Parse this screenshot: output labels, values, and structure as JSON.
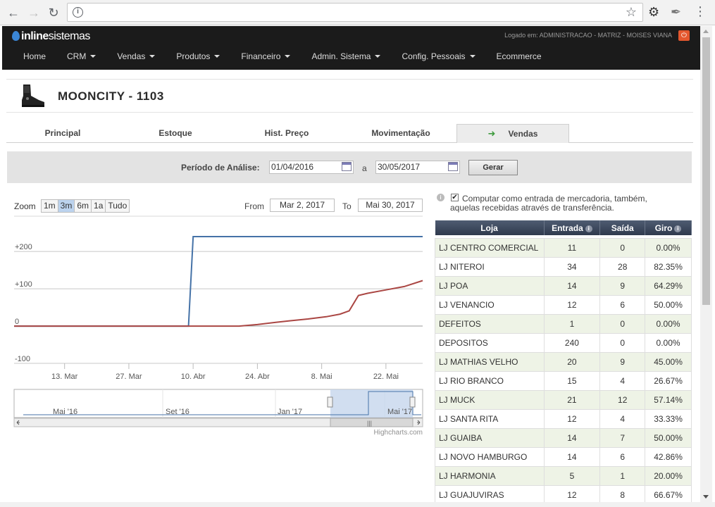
{
  "browser": {
    "address": ""
  },
  "header": {
    "user_info": "Logado em: ADMINISTRACAO - MATRIZ - MOISES VIANA",
    "logo_bold": "inline",
    "logo_light": "sistemas",
    "menu": [
      "Home",
      "CRM",
      "Vendas",
      "Produtos",
      "Financeiro",
      "Admin. Sistema",
      "Config. Pessoais",
      "Ecommerce"
    ]
  },
  "product": {
    "title": "MOONCITY - 1103"
  },
  "tabs": [
    "Principal",
    "Estoque",
    "Hist. Preço",
    "Movimentação",
    "Vendas"
  ],
  "period": {
    "label": "Período de Análise:",
    "from": "01/04/2016",
    "sep": "a",
    "to": "30/05/2017",
    "button": "Gerar"
  },
  "zoom": {
    "label": "Zoom",
    "buttons": [
      "1m",
      "3m",
      "6m",
      "1a",
      "Tudo"
    ],
    "selected": "3m",
    "from_label": "From",
    "from_value": "Mar 2, 2017",
    "to_label": "To",
    "to_value": "Mai 30, 2017"
  },
  "colors": {
    "series_entrada": "#4572a7",
    "series_saida": "#aa4643"
  },
  "chart_data": {
    "type": "line",
    "yticks": [
      "+200",
      "+100",
      "0",
      "-100"
    ],
    "y_tick_values": [
      200,
      100,
      0,
      -100
    ],
    "ylim": [
      -100,
      240
    ],
    "xticks": [
      "13. Mar",
      "27. Mar",
      "10. Abr",
      "24. Abr",
      "8. Mai",
      "22. Mai"
    ],
    "x_tick_dates": [
      "2017-03-13",
      "2017-03-27",
      "2017-04-10",
      "2017-04-24",
      "2017-05-08",
      "2017-05-22"
    ],
    "xlim": [
      "2017-03-02",
      "2017-05-30"
    ],
    "series": [
      {
        "x": [
          "2017-03-02",
          "2017-04-09",
          "2017-04-10",
          "2017-05-30"
        ],
        "y": [
          0,
          0,
          240,
          240
        ]
      },
      {
        "x": [
          "2017-03-02",
          "2017-04-10",
          "2017-04-20",
          "2017-04-24",
          "2017-04-28",
          "2017-05-01",
          "2017-05-05",
          "2017-05-09",
          "2017-05-12",
          "2017-05-14",
          "2017-05-16",
          "2017-05-18",
          "2017-05-22",
          "2017-05-26",
          "2017-05-30"
        ],
        "y": [
          0,
          0,
          0,
          4,
          10,
          14,
          19,
          25,
          32,
          41,
          82,
          88,
          97,
          106,
          122
        ]
      }
    ],
    "navigator_labels": [
      "Mai '16",
      "Set '16",
      "Jan '17",
      "Mai '17"
    ],
    "credits": "Highcharts.com"
  },
  "panel": {
    "checkbox_checked": "✔",
    "checkbox_line1": "Computar como entrada de mercadoria, também,",
    "checkbox_line2": "aquelas recebidas através de transferência.",
    "columns": [
      "Loja",
      "Entrada",
      "Saída",
      "Giro"
    ],
    "rows": [
      [
        "LJ CENTRO COMERCIAL",
        "11",
        "0",
        "0.00%"
      ],
      [
        "LJ NITEROI",
        "34",
        "28",
        "82.35%"
      ],
      [
        "LJ POA",
        "14",
        "9",
        "64.29%"
      ],
      [
        "LJ VENANCIO",
        "12",
        "6",
        "50.00%"
      ],
      [
        "DEFEITOS",
        "1",
        "0",
        "0.00%"
      ],
      [
        "DEPOSITOS",
        "240",
        "0",
        "0.00%"
      ],
      [
        "LJ MATHIAS VELHO",
        "20",
        "9",
        "45.00%"
      ],
      [
        "LJ RIO BRANCO",
        "15",
        "4",
        "26.67%"
      ],
      [
        "LJ MUCK",
        "21",
        "12",
        "57.14%"
      ],
      [
        "LJ SANTA RITA",
        "12",
        "4",
        "33.33%"
      ],
      [
        "LJ GUAIBA",
        "14",
        "7",
        "50.00%"
      ],
      [
        "LJ NOVO HAMBURGO",
        "14",
        "6",
        "42.86%"
      ],
      [
        "LJ HARMONIA",
        "5",
        "1",
        "20.00%"
      ],
      [
        "LJ GUAJUVIRAS",
        "12",
        "8",
        "66.67%"
      ]
    ]
  }
}
